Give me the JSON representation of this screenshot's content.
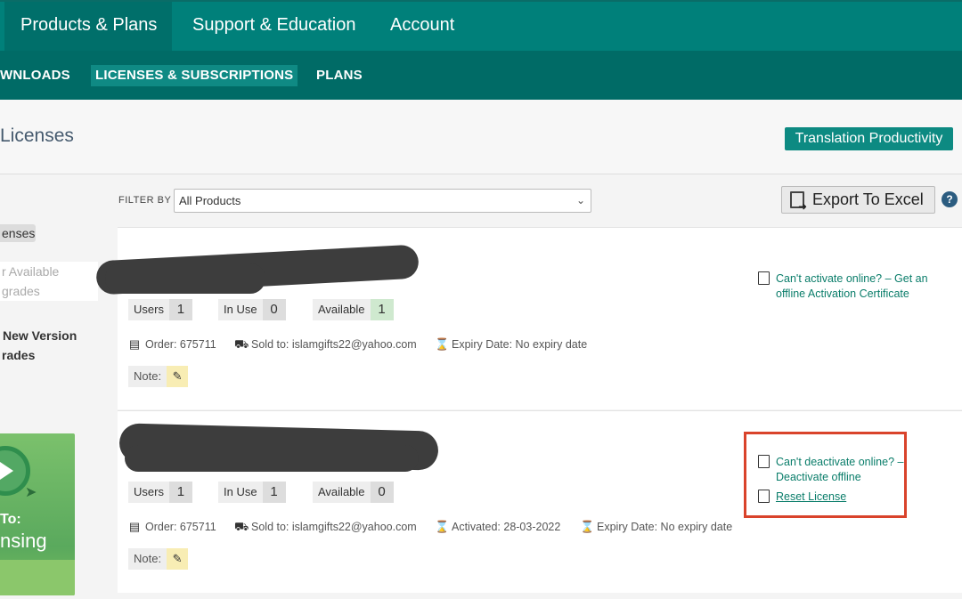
{
  "topnav": {
    "tabs": [
      {
        "label": "Products & Plans",
        "active": true
      },
      {
        "label": "Support & Education",
        "active": false
      },
      {
        "label": "Account",
        "active": false
      }
    ]
  },
  "subnav": {
    "items": [
      {
        "label": "WNLOADS",
        "active": false
      },
      {
        "label": "LICENSES & SUBSCRIPTIONS",
        "active": true
      },
      {
        "label": "PLANS",
        "active": false
      }
    ]
  },
  "page": {
    "title": "Licenses",
    "tp_button": "Translation Productivity"
  },
  "sidebar": {
    "item1": "enses",
    "item2_line1": "r Available",
    "item2_line2": "grades",
    "item3_line1": "New Version",
    "item3_line2": "rades",
    "promo_line1": "To:",
    "promo_line2": "nsing"
  },
  "filter": {
    "label": "FILTER BY",
    "selected": "All Products"
  },
  "export_label": "Export To Excel",
  "help_label": "?",
  "licenses": [
    {
      "users_label": "Users",
      "users": "1",
      "inuse_label": "In Use",
      "inuse": "0",
      "available_label": "Available",
      "available": "1",
      "order": "Order: 675711",
      "sold_to": "Sold to: islamgifts22@yahoo.com",
      "expiry": "Expiry Date: No expiry date",
      "note_label": "Note:",
      "action_line1": "Can't activate online? – Get an",
      "action_line2": "offline Activation Certificate"
    },
    {
      "users_label": "Users",
      "users": "1",
      "inuse_label": "In Use",
      "inuse": "1",
      "available_label": "Available",
      "available": "0",
      "order": "Order: 675711",
      "sold_to": "Sold to: islamgifts22@yahoo.com",
      "activated": "Activated: 28-03-2022",
      "expiry": "Expiry Date: No expiry date",
      "note_label": "Note:",
      "action_line1": "Can't deactivate online? –",
      "action_line2": "Deactivate offline",
      "reset_label": "Reset License"
    }
  ],
  "colors": {
    "nav_primary": "#00807a",
    "nav_secondary": "#006b66",
    "accent": "#0d8a82",
    "highlight": "#d9432b"
  }
}
